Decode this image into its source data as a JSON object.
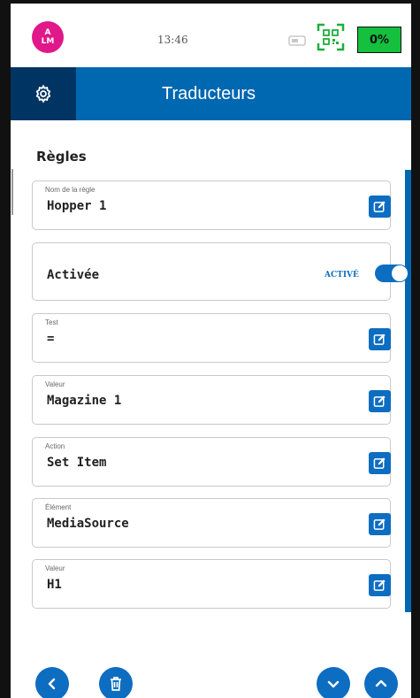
{
  "status_bar": {
    "avatar_line1": "A",
    "avatar_line2": "LM",
    "time": "13:46",
    "battery": "0%"
  },
  "header": {
    "title": "Traducteurs"
  },
  "section": {
    "title": "Règles"
  },
  "fields": [
    {
      "label": "Nom de la règle",
      "value": "Hopper 1"
    },
    {
      "label": "Test",
      "value": "="
    },
    {
      "label": "Valeur",
      "value": "Magazine 1"
    },
    {
      "label": "Action",
      "value": "Set Item"
    },
    {
      "label": "Élément",
      "value": "MediaSource"
    },
    {
      "label": "Valeur",
      "value": "H1"
    }
  ],
  "toggle": {
    "label": "Activée",
    "status": "ACTIVÉ",
    "on": true
  },
  "colors": {
    "header_blue": "#0067b1",
    "header_dark": "#003463",
    "accent": "#0d6dc1",
    "avatar": "#e0188a",
    "battery": "#14c03e"
  },
  "icons": {
    "header": "gear-icon",
    "status": [
      "cast-icon",
      "qr-code-icon"
    ],
    "edit": "edit-icon",
    "bottom": [
      "chevron-left-icon",
      "trash-icon",
      "chevron-down-icon",
      "chevron-up-icon"
    ]
  }
}
